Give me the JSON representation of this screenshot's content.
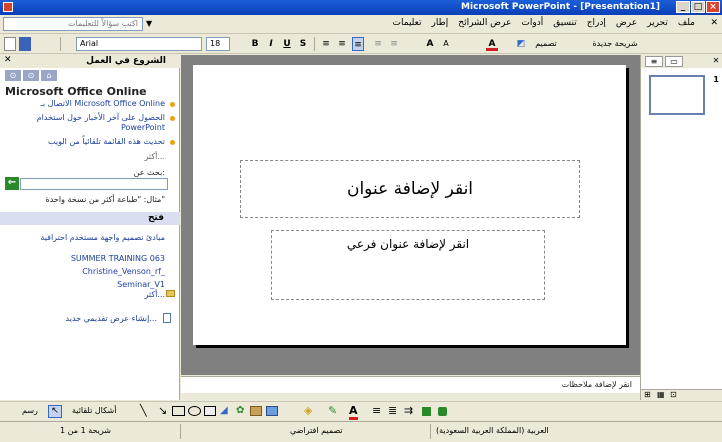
{
  "window": {
    "title": "Microsoft PowerPoint - [Presentation1]",
    "controls": [
      "_",
      "□",
      "×"
    ]
  },
  "menu": {
    "items": [
      "ملف",
      "تحرير",
      "عرض",
      "إدراج",
      "تنسيق",
      "أدوات",
      "عرض الشرائح",
      "إطار",
      "تعليمات"
    ],
    "help_placeholder": "اكتب سؤالاً للتعليمات"
  },
  "toolbar": {
    "font_name": "Arial",
    "font_size": "18",
    "bold": "B",
    "italic": "I",
    "underline": "U",
    "shadow": "S",
    "design_label": "تصميم",
    "new_slide_label": "شريحة جديدة"
  },
  "taskpane": {
    "title": "الشروع في العمل",
    "office_title": "Microsoft Office Online",
    "links": [
      "الاتصال بـ Microsoft Office Online",
      "الحصول على آخر الأخبار حول استخدام PowerPoint",
      "تحديث هذه القائمة تلقائياً من الويب"
    ],
    "more": "أكثر...",
    "search_label": "بحث عن:",
    "search_value": "",
    "example": "مثال: \"طباعة أكثر من نسخة واحدة\"",
    "open_header": "فتح",
    "files": [
      "مبادئ تصميم واجهة مستخدم احترافية",
      "SUMMER TRAINING 063",
      "Christine_Venson_rf_",
      "Seminar_V1"
    ],
    "more_files": "أكثر...",
    "new_presentation": "إنشاء عرض تقديمي جديد..."
  },
  "slide": {
    "title_placeholder": "انقر لإضافة عنوان",
    "subtitle_placeholder": "انقر لإضافة عنوان فرعي"
  },
  "notes": {
    "placeholder": "انقر لإضافة ملاحظات"
  },
  "thumbnails": {
    "slide_number": "1"
  },
  "drawbar": {
    "draw_label": "رسم",
    "autoshapes_label": "أشكال تلقائية"
  },
  "status": {
    "slide_info": "شريحة 1 من 1",
    "design": "تصميم افتراضي",
    "language": "العربية (المملكة العربية السعودية)"
  },
  "colors": {
    "title_bar": "#0a3fb8",
    "chrome": "#ece9d8",
    "workspace": "#808080",
    "link": "#1b3f9c"
  }
}
